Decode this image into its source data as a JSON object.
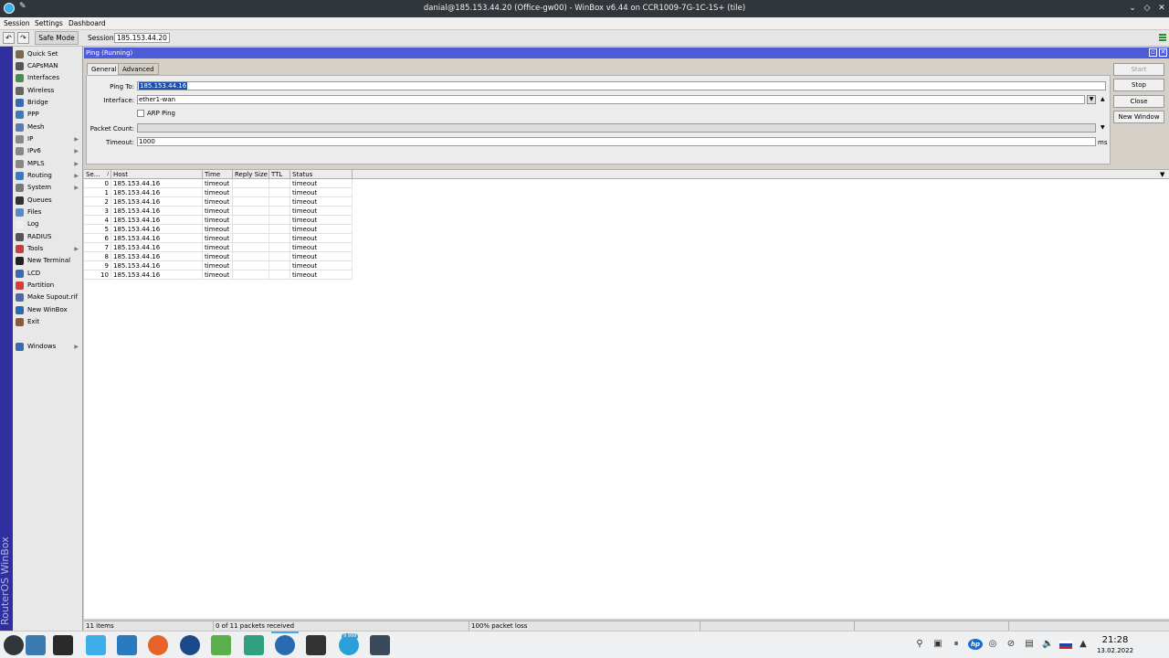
{
  "window": {
    "title": "danial@185.153.44.20 (Office-gw00) - WinBox v6.44 on CCR1009-7G-1C-1S+ (tile)"
  },
  "menu": {
    "session": "Session",
    "settings": "Settings",
    "dashboard": "Dashboard"
  },
  "toolbar": {
    "undo": "↶",
    "redo": "↷",
    "safe_mode": "Safe Mode",
    "session_label": "Session:",
    "session_value": "185.153.44.20"
  },
  "brand": "RouterOS WinBox",
  "sidebar": {
    "items": [
      {
        "label": "Quick Set",
        "icon": "quickset-icon",
        "color": "#7a6a4a"
      },
      {
        "label": "CAPsMAN",
        "icon": "capsman-icon",
        "color": "#555555"
      },
      {
        "label": "Interfaces",
        "icon": "interfaces-icon",
        "color": "#4a8c4a"
      },
      {
        "label": "Wireless",
        "icon": "wireless-icon",
        "color": "#666666"
      },
      {
        "label": "Bridge",
        "icon": "bridge-icon",
        "color": "#3a6ab0"
      },
      {
        "label": "PPP",
        "icon": "ppp-icon",
        "color": "#3a7ac0"
      },
      {
        "label": "Mesh",
        "icon": "mesh-icon",
        "color": "#5a7ab0"
      },
      {
        "label": "IP",
        "icon": "ip-icon",
        "color": "#888888",
        "submenu": true
      },
      {
        "label": "IPv6",
        "icon": "ipv6-icon",
        "color": "#888888",
        "submenu": true
      },
      {
        "label": "MPLS",
        "icon": "mpls-icon",
        "color": "#888888",
        "submenu": true
      },
      {
        "label": "Routing",
        "icon": "routing-icon",
        "color": "#3a7ac0",
        "submenu": true
      },
      {
        "label": "System",
        "icon": "system-icon",
        "color": "#777777",
        "submenu": true
      },
      {
        "label": "Queues",
        "icon": "queues-icon",
        "color": "#333333"
      },
      {
        "label": "Files",
        "icon": "files-icon",
        "color": "#5a8ac0"
      },
      {
        "label": "Log",
        "icon": "log-icon",
        "color": "#eeeeee"
      },
      {
        "label": "RADIUS",
        "icon": "radius-icon",
        "color": "#555555"
      },
      {
        "label": "Tools",
        "icon": "tools-icon",
        "color": "#c04040",
        "submenu": true
      },
      {
        "label": "New Terminal",
        "icon": "terminal-icon",
        "color": "#222222"
      },
      {
        "label": "LCD",
        "icon": "lcd-icon",
        "color": "#3a6ab0"
      },
      {
        "label": "Partition",
        "icon": "partition-icon",
        "color": "#d04040"
      },
      {
        "label": "Make Supout.rif",
        "icon": "supout-icon",
        "color": "#4a6ab0"
      },
      {
        "label": "New WinBox",
        "icon": "winbox-icon",
        "color": "#2a6ab0"
      },
      {
        "label": "Exit",
        "icon": "exit-icon",
        "color": "#8a5a3a"
      }
    ],
    "windows": {
      "label": "Windows",
      "icon": "windows-icon",
      "color": "#3a6ab0",
      "submenu": true
    }
  },
  "ping": {
    "title": "Ping (Running)",
    "tabs": [
      "General",
      "Advanced"
    ],
    "fields": {
      "ping_to_label": "Ping To:",
      "ping_to_value": "185.153.44.16",
      "interface_label": "Interface:",
      "interface_value": "ether1-wan",
      "arp_ping_label": "ARP Ping",
      "packet_count_label": "Packet Count:",
      "timeout_label": "Timeout:",
      "timeout_value": "1000",
      "timeout_unit": "ms"
    },
    "buttons": {
      "start": "Start",
      "stop": "Stop",
      "close": "Close",
      "new_window": "New Window"
    },
    "columns": [
      "Se...",
      "Host",
      "Time",
      "Reply Size",
      "TTL",
      "Status"
    ],
    "rows": [
      {
        "seq": "0",
        "host": "185.153.44.16",
        "time": "timeout",
        "reply_size": "",
        "ttl": "",
        "status": "timeout"
      },
      {
        "seq": "1",
        "host": "185.153.44.16",
        "time": "timeout",
        "reply_size": "",
        "ttl": "",
        "status": "timeout"
      },
      {
        "seq": "2",
        "host": "185.153.44.16",
        "time": "timeout",
        "reply_size": "",
        "ttl": "",
        "status": "timeout"
      },
      {
        "seq": "3",
        "host": "185.153.44.16",
        "time": "timeout",
        "reply_size": "",
        "ttl": "",
        "status": "timeout"
      },
      {
        "seq": "4",
        "host": "185.153.44.16",
        "time": "timeout",
        "reply_size": "",
        "ttl": "",
        "status": "timeout"
      },
      {
        "seq": "5",
        "host": "185.153.44.16",
        "time": "timeout",
        "reply_size": "",
        "ttl": "",
        "status": "timeout"
      },
      {
        "seq": "6",
        "host": "185.153.44.16",
        "time": "timeout",
        "reply_size": "",
        "ttl": "",
        "status": "timeout"
      },
      {
        "seq": "7",
        "host": "185.153.44.16",
        "time": "timeout",
        "reply_size": "",
        "ttl": "",
        "status": "timeout"
      },
      {
        "seq": "8",
        "host": "185.153.44.16",
        "time": "timeout",
        "reply_size": "",
        "ttl": "",
        "status": "timeout"
      },
      {
        "seq": "9",
        "host": "185.153.44.16",
        "time": "timeout",
        "reply_size": "",
        "ttl": "",
        "status": "timeout"
      },
      {
        "seq": "10",
        "host": "185.153.44.16",
        "time": "timeout",
        "reply_size": "",
        "ttl": "",
        "status": "timeout"
      }
    ],
    "status": {
      "items": "11 items",
      "received": "0 of 11 packets received",
      "loss": "100% packet loss"
    }
  },
  "taskbar": {
    "apps": [
      {
        "name": "app-launcher-icon",
        "color": "#31363b"
      },
      {
        "name": "desktop-icon",
        "color": "#3a7ab0"
      },
      {
        "name": "task-manager-icon",
        "color": "#2a2a2a"
      },
      {
        "name": "discover-icon",
        "color": "#3daee9"
      },
      {
        "name": "dolphin-icon",
        "color": "#2a7ac0"
      },
      {
        "name": "firefox-icon",
        "color": "#e8632a"
      },
      {
        "name": "remmina-icon",
        "color": "#1a4a8a"
      },
      {
        "name": "notes-icon",
        "color": "#5ab04a"
      },
      {
        "name": "winbox-launcher-icon",
        "color": "#30a080"
      },
      {
        "name": "winbox-active-icon",
        "color": "#2a6ab0"
      },
      {
        "name": "konsole-icon",
        "color": "#333333"
      },
      {
        "name": "telegram-icon",
        "color": "#2aa0d8"
      },
      {
        "name": "screenshot-icon",
        "color": "#3a4a5a"
      }
    ],
    "telegram_badge": "9 999",
    "time": "21:28",
    "date": "13.02.2022"
  }
}
